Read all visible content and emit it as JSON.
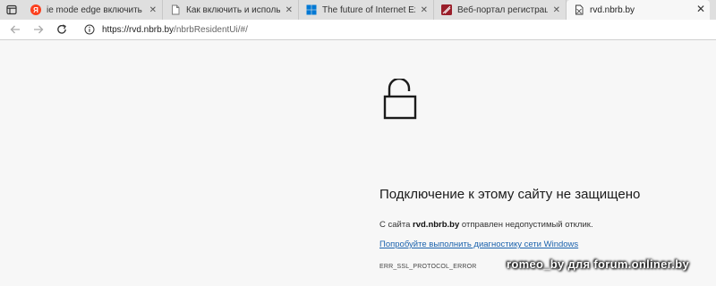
{
  "tabs": [
    {
      "title": "ie mode edge включить — Янде",
      "favicon": "yandex-icon",
      "color": "#fc3f1d"
    },
    {
      "title": "Как включить и использовать р",
      "favicon": "page-icon",
      "color": "#888888"
    },
    {
      "title": "The future of Internet Explorer o",
      "favicon": "windows-icon",
      "color": "#0078d4"
    },
    {
      "title": "Веб-портал регистрации валю",
      "favicon": "nbrb-icon",
      "color": "#9a1e2a"
    },
    {
      "title": "rvd.nbrb.by",
      "favicon": "not-secure-page-icon",
      "active": true
    }
  ],
  "address": {
    "host": "https://rvd.nbrb.by",
    "path": "/nbrbResidentUi/#/"
  },
  "error": {
    "title": "Подключение к этому сайту не защищено",
    "desc_prefix": "С сайта ",
    "desc_host": "rvd.nbrb.by",
    "desc_suffix": " отправлен недопустимый отклик.",
    "link": "Попробуйте выполнить диагностику сети Windows",
    "code": "ERR_SSL_PROTOCOL_ERROR"
  },
  "watermark": "romeo_by для forum.onliner.by"
}
